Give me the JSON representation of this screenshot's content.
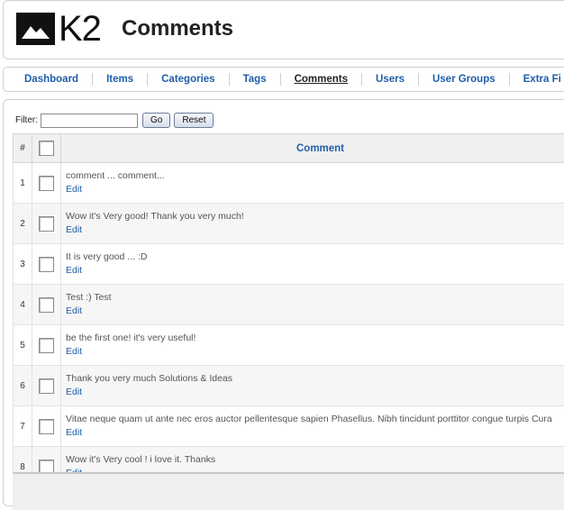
{
  "header": {
    "logo_text": "K2",
    "title": "Comments"
  },
  "tabs": [
    {
      "label": "Dashboard"
    },
    {
      "label": "Items"
    },
    {
      "label": "Categories"
    },
    {
      "label": "Tags"
    },
    {
      "label": "Comments"
    },
    {
      "label": "Users"
    },
    {
      "label": "User Groups"
    },
    {
      "label": "Extra Fi"
    }
  ],
  "filter": {
    "label": "Filter:",
    "value": "",
    "go_label": "Go",
    "reset_label": "Reset"
  },
  "table": {
    "col_num": "#",
    "col_comment": "Comment",
    "edit_label": "Edit",
    "rows": [
      {
        "num": "1",
        "text": "comment ... comment..."
      },
      {
        "num": "2",
        "text": "Wow it's Very good! Thank you very much!"
      },
      {
        "num": "3",
        "text": "It is very good ... :D"
      },
      {
        "num": "4",
        "text": "Test :) Test"
      },
      {
        "num": "5",
        "text": "be the first one! it's very useful!"
      },
      {
        "num": "6",
        "text": "Thank you very much Solutions & Ideas"
      },
      {
        "num": "7",
        "text": "Vitae neque quam ut ante nec eros auctor pellentesque sapien Phasellus. Nibh tincidunt porttitor congue turpis Cura"
      },
      {
        "num": "8",
        "text": "Wow it's Very cool ! i love it. Thanks"
      }
    ]
  },
  "colors": {
    "link": "#1f5ea8",
    "border": "#cfcfcf",
    "row_alt": "#f6f6f6"
  }
}
